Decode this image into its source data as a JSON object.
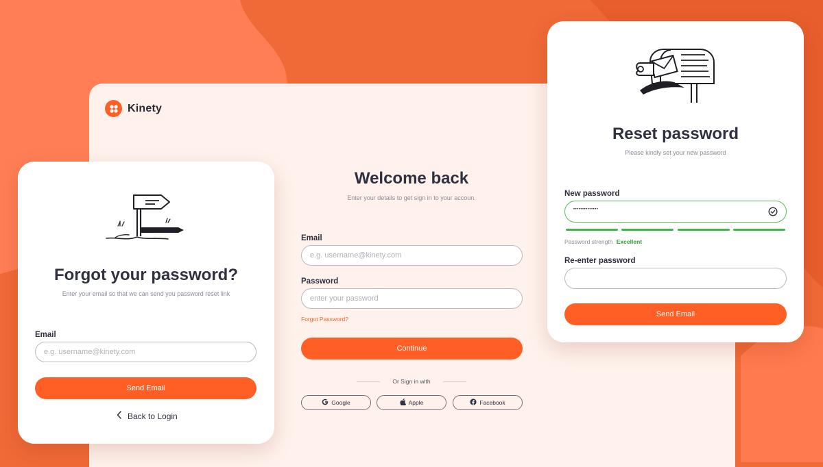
{
  "brand": {
    "name": "Kinety"
  },
  "login": {
    "title": "Welcome back",
    "subtitle": "Enter your details to get sign in to your accoun.",
    "email_label": "Email",
    "email_placeholder": "e.g. username@kinety.com",
    "password_label": "Password",
    "password_placeholder": "enter your password",
    "forgot_link": "Forgot Password?",
    "continue_label": "Continue",
    "divider": "Or Sign in with",
    "social": [
      {
        "label": "Google",
        "icon": "google-icon"
      },
      {
        "label": "Apple",
        "icon": "apple-icon"
      },
      {
        "label": "Facebook",
        "icon": "facebook-icon"
      }
    ]
  },
  "forgot": {
    "title": "Forgot your password?",
    "subtitle": "Enter your email so that we can send you password reset link",
    "email_label": "Email",
    "email_placeholder": "e.g. username@kinety.com",
    "send_label": "Send Email",
    "back_label": "Back to Login",
    "illustration": "signpost-illustration"
  },
  "reset": {
    "title": "Reset password",
    "subtitle": "Please kindly set your new password",
    "new_label": "New password",
    "new_value": "••••••••••••••",
    "strength_label": "Password strength",
    "strength_value": "Excellent",
    "strength_level": 1.0,
    "reenter_label": "Re-enter password",
    "reenter_value": "",
    "send_label": "Send Email",
    "illustration": "mailbox-illustration"
  },
  "colors": {
    "accent": "#FF5F24",
    "background": "#F06A37",
    "panel": "#FFF2EC",
    "success": "#41B549"
  }
}
